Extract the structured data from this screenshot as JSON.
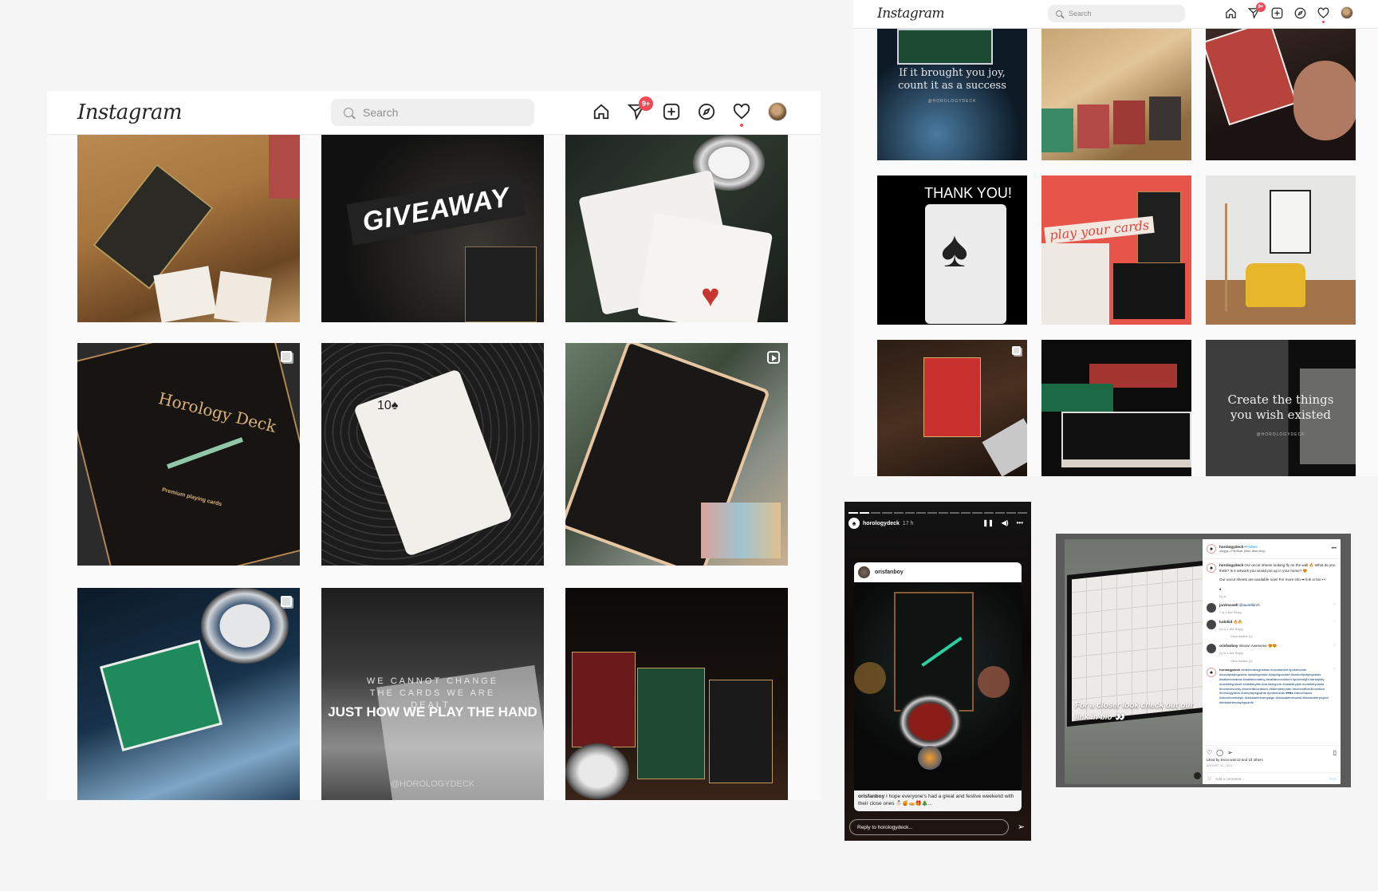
{
  "app": {
    "logo": "Instagram",
    "search_placeholder": "Search",
    "nav_icons": [
      "home-icon",
      "direct-messages-icon",
      "new-post-icon",
      "explore-icon",
      "activity-heart-icon",
      "profile-avatar"
    ],
    "dm_badge": "9+",
    "accent_color": "#ed4956"
  },
  "left_feed": {
    "tiles": [
      {
        "id": "wooden-table-decks",
        "caption": "",
        "indicator": ""
      },
      {
        "id": "giveaway",
        "caption": "GIVEAWAY",
        "indicator": ""
      },
      {
        "id": "royal-flush-watch",
        "caption": "",
        "indicator": ""
      },
      {
        "id": "horology-deck-box",
        "caption": "Horology Deck",
        "sub_caption": "Premium playing cards",
        "indicator": "multiple-posts-icon"
      },
      {
        "id": "pocket-watch-card",
        "caption": "",
        "indicator": ""
      },
      {
        "id": "gear-card-back",
        "caption": "",
        "indicator": "reel-icon"
      },
      {
        "id": "green-deck-watch",
        "caption": "",
        "indicator": "multiple-posts-icon"
      },
      {
        "id": "quote-play-the-hand",
        "caption_top": "WE CANNOT CHANGE THE CARDS WE ARE DEALT,",
        "caption": "JUST HOW WE PLAY THE HAND",
        "handle": "@HOROLOGYDECK",
        "indicator": ""
      },
      {
        "id": "three-decks-watch",
        "caption": "",
        "indicator": ""
      }
    ]
  },
  "right_feed": {
    "tiles": [
      {
        "id": "quote-joy",
        "caption": "If it brought you joy, count it as a success",
        "handle": "@HOROLOGYDECK",
        "indicator": ""
      },
      {
        "id": "decks-on-wood",
        "caption": "",
        "indicator": ""
      },
      {
        "id": "hands-red-cards",
        "caption": "",
        "indicator": ""
      },
      {
        "id": "thank-you-ace",
        "caption": "THANK YOU!",
        "indicator": ""
      },
      {
        "id": "play-your-cards",
        "caption": "play your cards",
        "indicator": ""
      },
      {
        "id": "yellow-chair-frame",
        "caption": "",
        "indicator": ""
      },
      {
        "id": "red-deck-camera",
        "caption": "",
        "indicator": "multiple-posts-icon"
      },
      {
        "id": "green-red-decks",
        "caption": "",
        "indicator": ""
      },
      {
        "id": "quote-create",
        "caption": "Create the things you wish existed",
        "handle": "@HOROLOGYDECK",
        "indicator": ""
      }
    ]
  },
  "story": {
    "username": "horologydeck",
    "time": "17 h",
    "progress_segments_total": 16,
    "progress_segments_done": 2,
    "controls": [
      "pause-icon",
      "mute-icon",
      "more-icon"
    ],
    "shared_post": {
      "username": "orisfanboy",
      "caption_user": "orisfanboy",
      "caption_text": "I hope everyone's had a great and festive weekend with their close ones ⛄🍯🥧🎁🎄..."
    },
    "reply_placeholder": "Reply to horologydeck..."
  },
  "post": {
    "image_caption": "For a closer look check out our link in bio 👀",
    "username": "horologydeck",
    "follow_label": "Follow",
    "audio": "zhiggs • FlipSide (feat. Alan Avy)",
    "caption_user": "horologydeck",
    "caption_text": "Our uncut sheets looking fly on the wall 🔥 What do you think? Is it artwork you would put up in your home? 😍",
    "caption_text2": "Our uncut sheets are available now! For more info ➡ link in bio 👀",
    "caption_bullet": "♠",
    "caption_age": "2y w",
    "comments": [
      {
        "user": "jordrossell",
        "text": "@lauriebirch",
        "meta": "7 w   1 like   Reply",
        "view_replies": ""
      },
      {
        "user": "ludokid",
        "text": "🔥🔥",
        "meta": "2y w   1 like   Reply",
        "view_replies": "View replies (1)"
      },
      {
        "user": "orisfanboy",
        "text": "Woow! Awesome 😍😍",
        "meta": "2y w   1 like   Reply",
        "view_replies": "View replies (1)"
      }
    ],
    "hashtag_user": "horologydeck",
    "hashtags": "#interiordesignideas #uncutsheet #pokercards #uncutplayingcards #playingcards #playingcardart #customplayingcards #walldecorideas #walldecorating #walldecorcustom #pokernight #artofplay #cardistryplanet #cardistrylife #cardistryporn #cardistryjam #cardistrycards #homedecordiy #homedecorations #hammerkonter #homeofficedecoration #horologydeck #rareplayingcards #pokercards ♠♥♣♦ #decorhacks #decorhomestyle #kickstartercampaign #kickstarterreward #kickstarterproject #kickstarterplayingcards",
    "likes_text": "Liked by levon.warr12 and 23 others",
    "date": "AUGUST 11, 2021",
    "comment_placeholder": "Add a comment...",
    "post_button": "Post"
  }
}
